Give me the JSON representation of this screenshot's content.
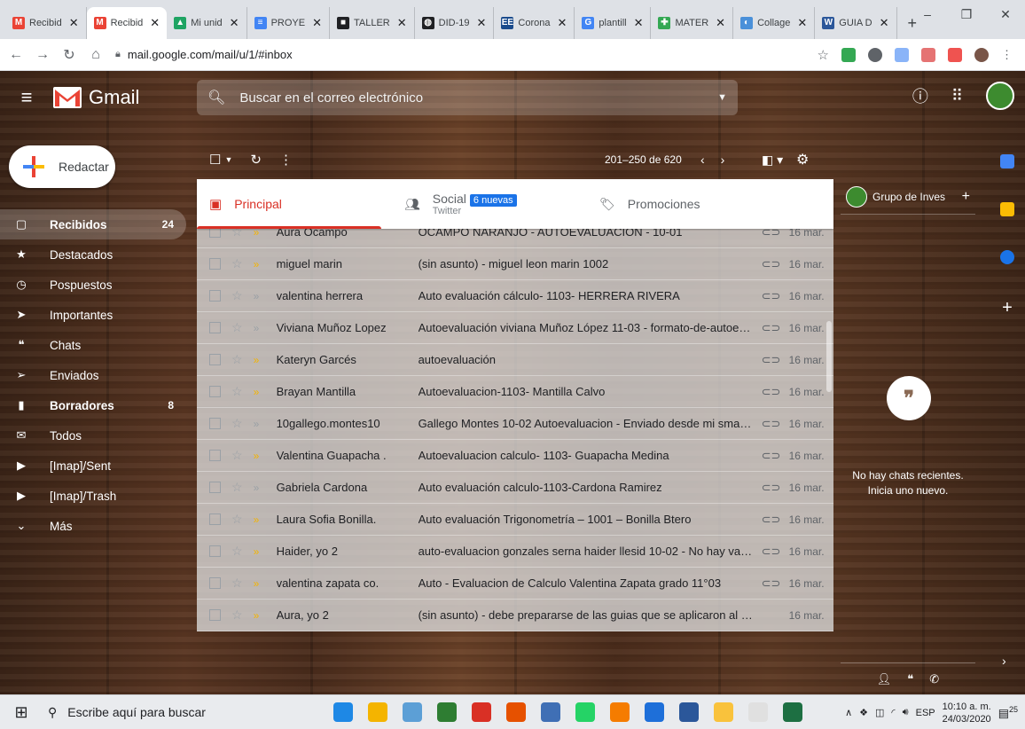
{
  "browser": {
    "tabs": [
      {
        "label": "Recibid",
        "fav": "M",
        "color": "#ea4335"
      },
      {
        "label": "Recibid",
        "fav": "M",
        "color": "#ea4335",
        "active": true
      },
      {
        "label": "Mi unid",
        "fav": "▲",
        "color": "#1fa463"
      },
      {
        "label": "PROYE",
        "fav": "≡",
        "color": "#4285f4"
      },
      {
        "label": "TALLER",
        "fav": "■",
        "color": "#202124"
      },
      {
        "label": "DID-19",
        "fav": "◍",
        "color": "#202124"
      },
      {
        "label": "Corona",
        "fav": "EE",
        "color": "#1a4b8c"
      },
      {
        "label": "plantill",
        "fav": "G",
        "color": "#4285f4"
      },
      {
        "label": "MATER",
        "fav": "✚",
        "color": "#34a853"
      },
      {
        "label": "Collage",
        "fav": "◐",
        "color": "#4a90d9"
      },
      {
        "label": "GUIA D",
        "fav": "W",
        "color": "#2b579a"
      }
    ],
    "url": "mail.google.com/mail/u/1/#inbox"
  },
  "gmail": {
    "product": "Gmail",
    "search_placeholder": "Buscar en el correo electrónico",
    "compose": "Redactar",
    "nav": [
      {
        "label": "Recibidos",
        "count": "24",
        "icon": "inbox-icon",
        "glyph": "▢",
        "bold": true,
        "selected": true
      },
      {
        "label": "Destacados",
        "count": "",
        "icon": "star-icon",
        "glyph": "★",
        "bold": false
      },
      {
        "label": "Pospuestos",
        "count": "",
        "icon": "clock-icon",
        "glyph": "◷",
        "bold": false
      },
      {
        "label": "Importantes",
        "count": "",
        "icon": "important-icon",
        "glyph": "➤",
        "bold": false
      },
      {
        "label": "Chats",
        "count": "",
        "icon": "chat-icon",
        "glyph": "❝",
        "bold": false
      },
      {
        "label": "Enviados",
        "count": "",
        "icon": "send-icon",
        "glyph": "➢",
        "bold": false
      },
      {
        "label": "Borradores",
        "count": "8",
        "icon": "draft-icon",
        "glyph": "▮",
        "bold": true
      },
      {
        "label": "Todos",
        "count": "",
        "icon": "all-mail-icon",
        "glyph": "✉",
        "bold": false
      },
      {
        "label": "[Imap]/Sent",
        "count": "",
        "icon": "label-icon",
        "glyph": "▶",
        "bold": false
      },
      {
        "label": "[Imap]/Trash",
        "count": "",
        "icon": "label-icon",
        "glyph": "▶",
        "bold": false
      },
      {
        "label": "Más",
        "count": "",
        "icon": "chevron-down-icon",
        "glyph": "⌄",
        "bold": false
      }
    ],
    "pagination": "201–250 de 620",
    "tabs": {
      "principal": "Principal",
      "social": "Social",
      "social_badge": "6 nuevas",
      "social_sub": "Twitter",
      "promociones": "Promociones"
    },
    "emails": [
      {
        "from": "Aura Ocampo",
        "subject": "OCAMPO NARANJO - AUTOEVALUACION - 10-01",
        "date": "16 mar.",
        "important": true,
        "clip": true
      },
      {
        "from": "miguel marin",
        "subject": "(sin asunto) - miguel leon marin 1002",
        "date": "16 mar.",
        "important": true,
        "clip": true
      },
      {
        "from": "valentina herrera",
        "subject": "Auto evaluación cálculo- 1103- HERRERA RIVERA",
        "date": "16 mar.",
        "important": false,
        "clip": true
      },
      {
        "from": "Viviana Muñoz Lopez",
        "subject": "Autoevaluación viviana Muñoz López 11-03 - formato-de-autoev...",
        "date": "16 mar.",
        "important": false,
        "clip": true
      },
      {
        "from": "Kateryn Garcés",
        "subject": "autoevaluación",
        "date": "16 mar.",
        "important": true,
        "clip": true
      },
      {
        "from": "Brayan Mantilla",
        "subject": "Autoevaluacion-1103- Mantilla Calvo",
        "date": "16 mar.",
        "important": true,
        "clip": true
      },
      {
        "from": "10gallego.montes10",
        "subject": "Gallego Montes 10-02 Autoevaluacion - Enviado desde mi smart...",
        "date": "16 mar.",
        "important": false,
        "clip": true
      },
      {
        "from": "Valentina Guapacha .",
        "subject": "Autoevaluacion calculo- 1103- Guapacha Medina",
        "date": "16 mar.",
        "important": true,
        "clip": true
      },
      {
        "from": "Gabriela Cardona",
        "subject": "Auto evaluación calculo-1103-Cardona Ramirez",
        "date": "16 mar.",
        "important": false,
        "clip": true
      },
      {
        "from": "Laura Sofia Bonilla.",
        "subject": "Auto evaluación Trigonometría – 1001 – Bonilla Btero",
        "date": "16 mar.",
        "important": true,
        "clip": true
      },
      {
        "from": "Haider, yo 2",
        "subject": "auto-evaluacion gonzales serna haider llesid 10-02 - No hay valo...",
        "date": "16 mar.",
        "important": true,
        "clip": true
      },
      {
        "from": "valentina zapata co.",
        "subject": "Auto - Evaluacion de Calculo Valentina Zapata grado 11°03",
        "date": "16 mar.",
        "important": true,
        "clip": true
      },
      {
        "from": "Aura, yo 2",
        "subject": "(sin asunto) - debe prepararse de las guias que se aplicaron al p...",
        "date": "16 mar.",
        "important": true,
        "clip": false
      }
    ],
    "chat": {
      "group": "Grupo de Inves",
      "empty_line1": "No hay chats recientes.",
      "empty_line2": "Inicia uno nuevo."
    }
  },
  "taskbar": {
    "search": "Escribe aquí para buscar",
    "lang": "ESP",
    "time": "10:10 a. m.",
    "date": "24/03/2020",
    "notif_count": "25",
    "apps": [
      "#1e88e5",
      "#f4b400",
      "#5c9fd6",
      "#2e7d32",
      "#d93025",
      "#e65100",
      "#3f6fb5",
      "#25d366",
      "#f57c00",
      "#1e6fd9",
      "#2b579a",
      "#f9c23c",
      "#e0e0e0",
      "#1d6f42"
    ]
  }
}
